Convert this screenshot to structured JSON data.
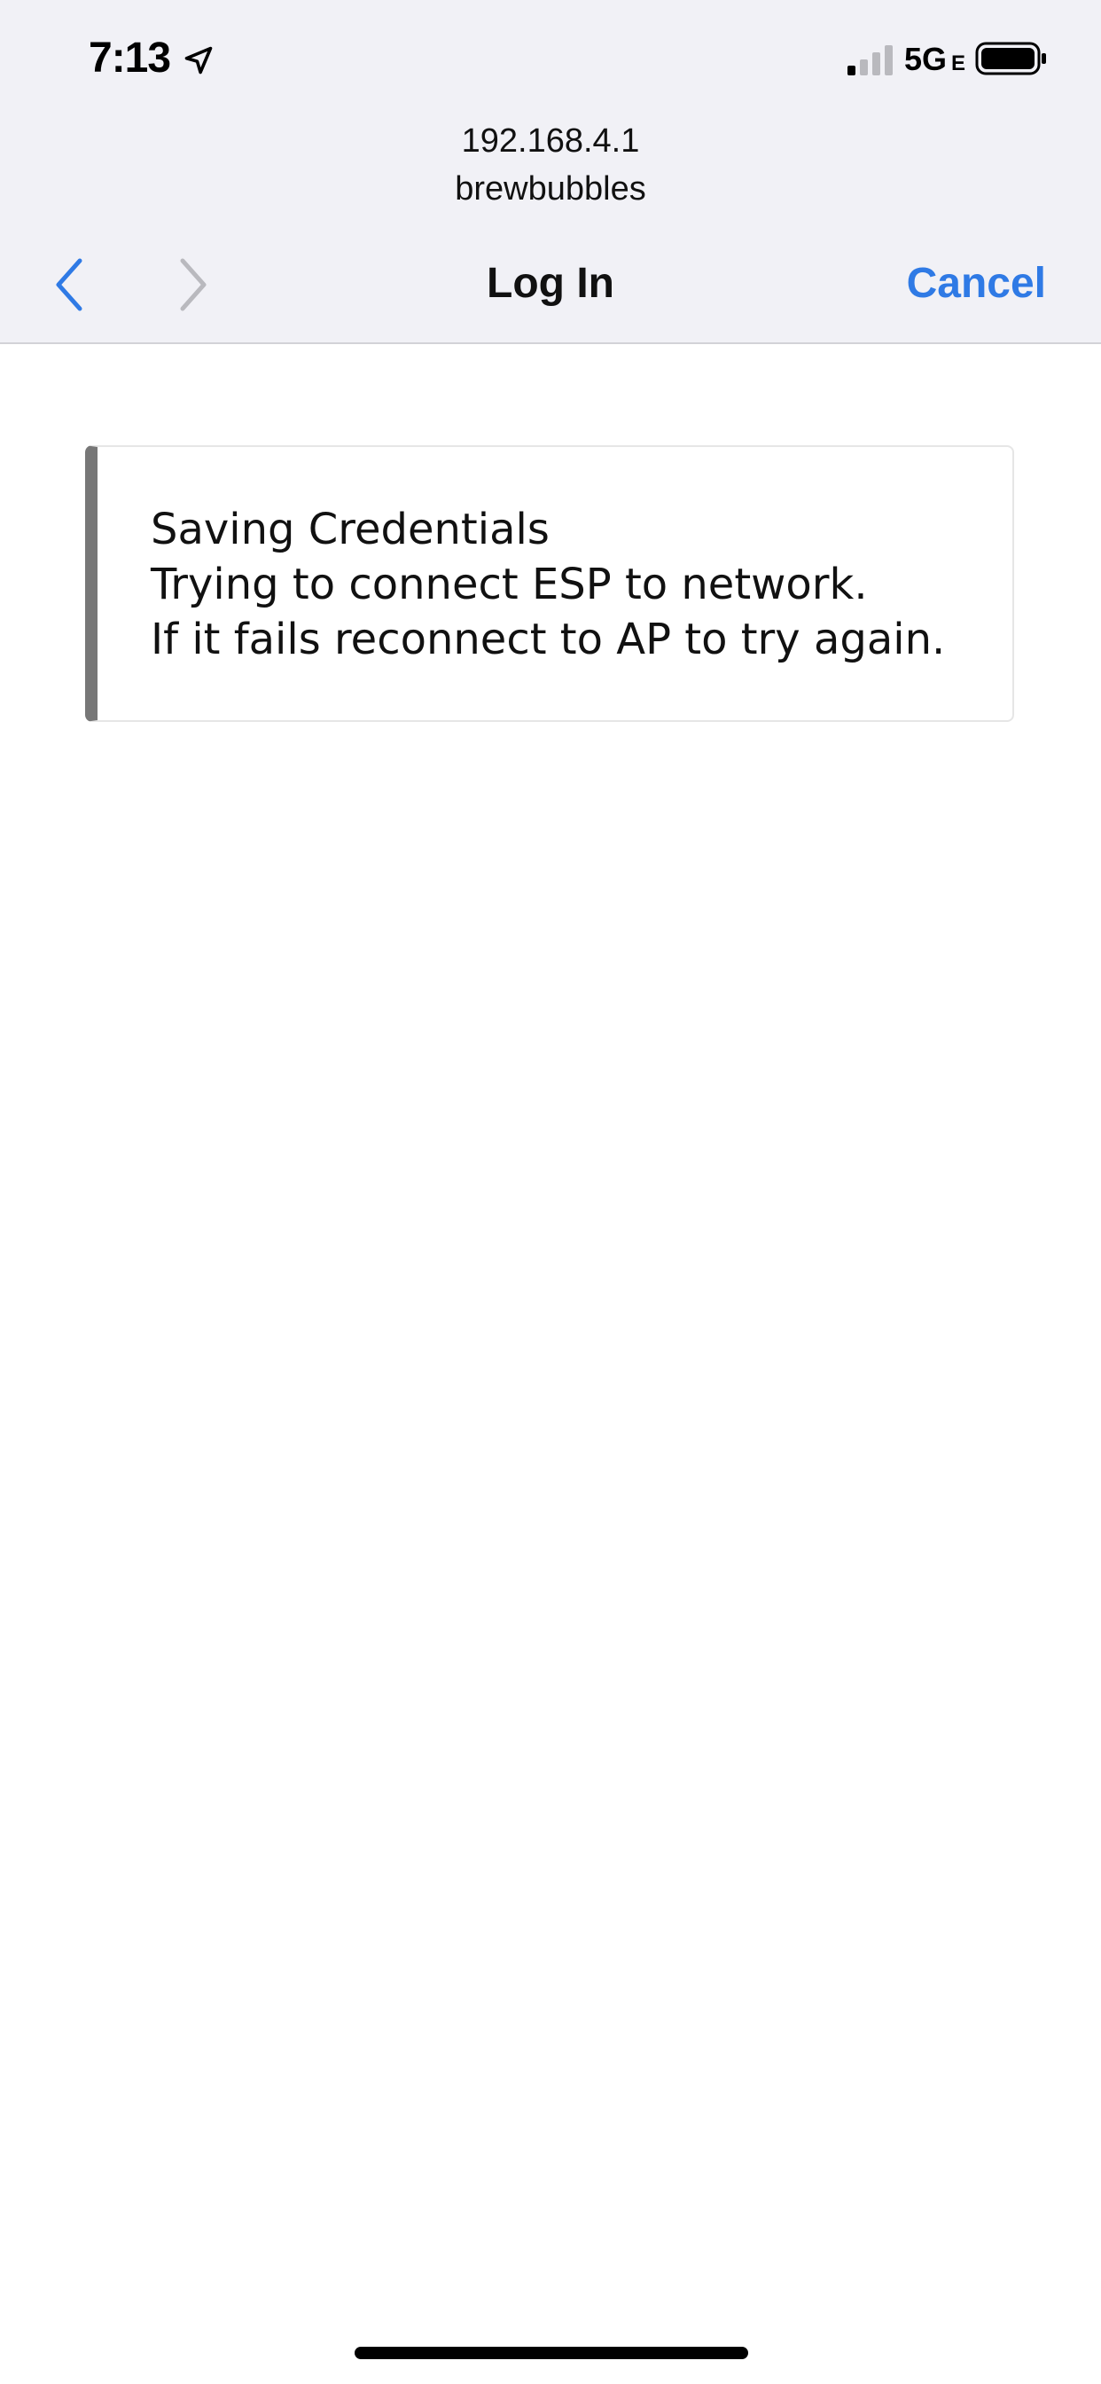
{
  "status_bar": {
    "time": "7:13",
    "network": "5G",
    "network_suffix": "E",
    "icons": [
      "location-arrow-icon",
      "signal-bars-icon",
      "battery-icon"
    ]
  },
  "header": {
    "url": "192.168.4.1",
    "site": "brewbubbles",
    "title": "Log In",
    "cancel_label": "Cancel",
    "back_icon": "chevron-left-icon",
    "forward_icon": "chevron-right-icon",
    "accent_color": "#2f7ae5"
  },
  "message": {
    "lines": [
      "Saving Credentials",
      "Trying to connect ESP to network.",
      "If it fails reconnect to AP to try again."
    ]
  }
}
